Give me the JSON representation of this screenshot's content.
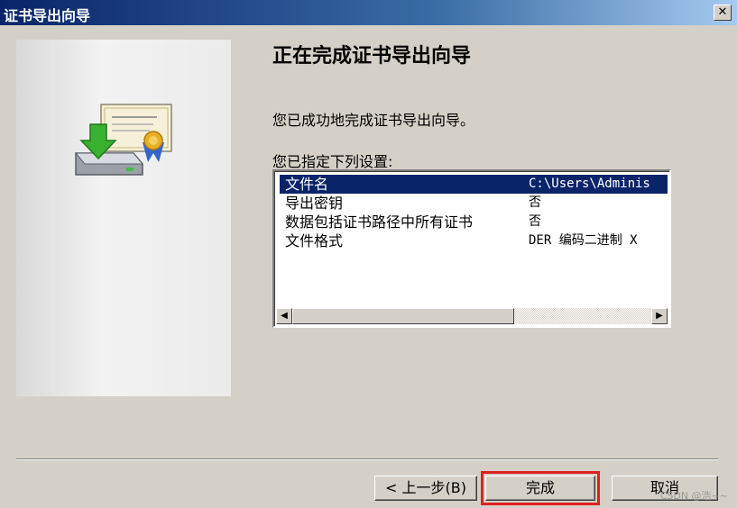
{
  "window": {
    "title": "证书导出向导",
    "close_label": "✕"
  },
  "content": {
    "heading": "正在完成证书导出向导",
    "success_message": "您已成功地完成证书导出向导。",
    "settings_label": "您已指定下列设置:"
  },
  "settings": [
    {
      "name": "文件名",
      "value": "C:\\Users\\Adminis"
    },
    {
      "name": "导出密钥",
      "value": "否"
    },
    {
      "name": "数据包括证书路径中所有证书",
      "value": "否"
    },
    {
      "name": "文件格式",
      "value": "DER 编码二进制 X"
    }
  ],
  "scrollbar": {
    "left_arrow": "◀",
    "right_arrow": "▶"
  },
  "buttons": {
    "back": "< 上一步(B)",
    "finish": "完成",
    "cancel": "取消"
  },
  "watermark": "CSDN @浩~~"
}
